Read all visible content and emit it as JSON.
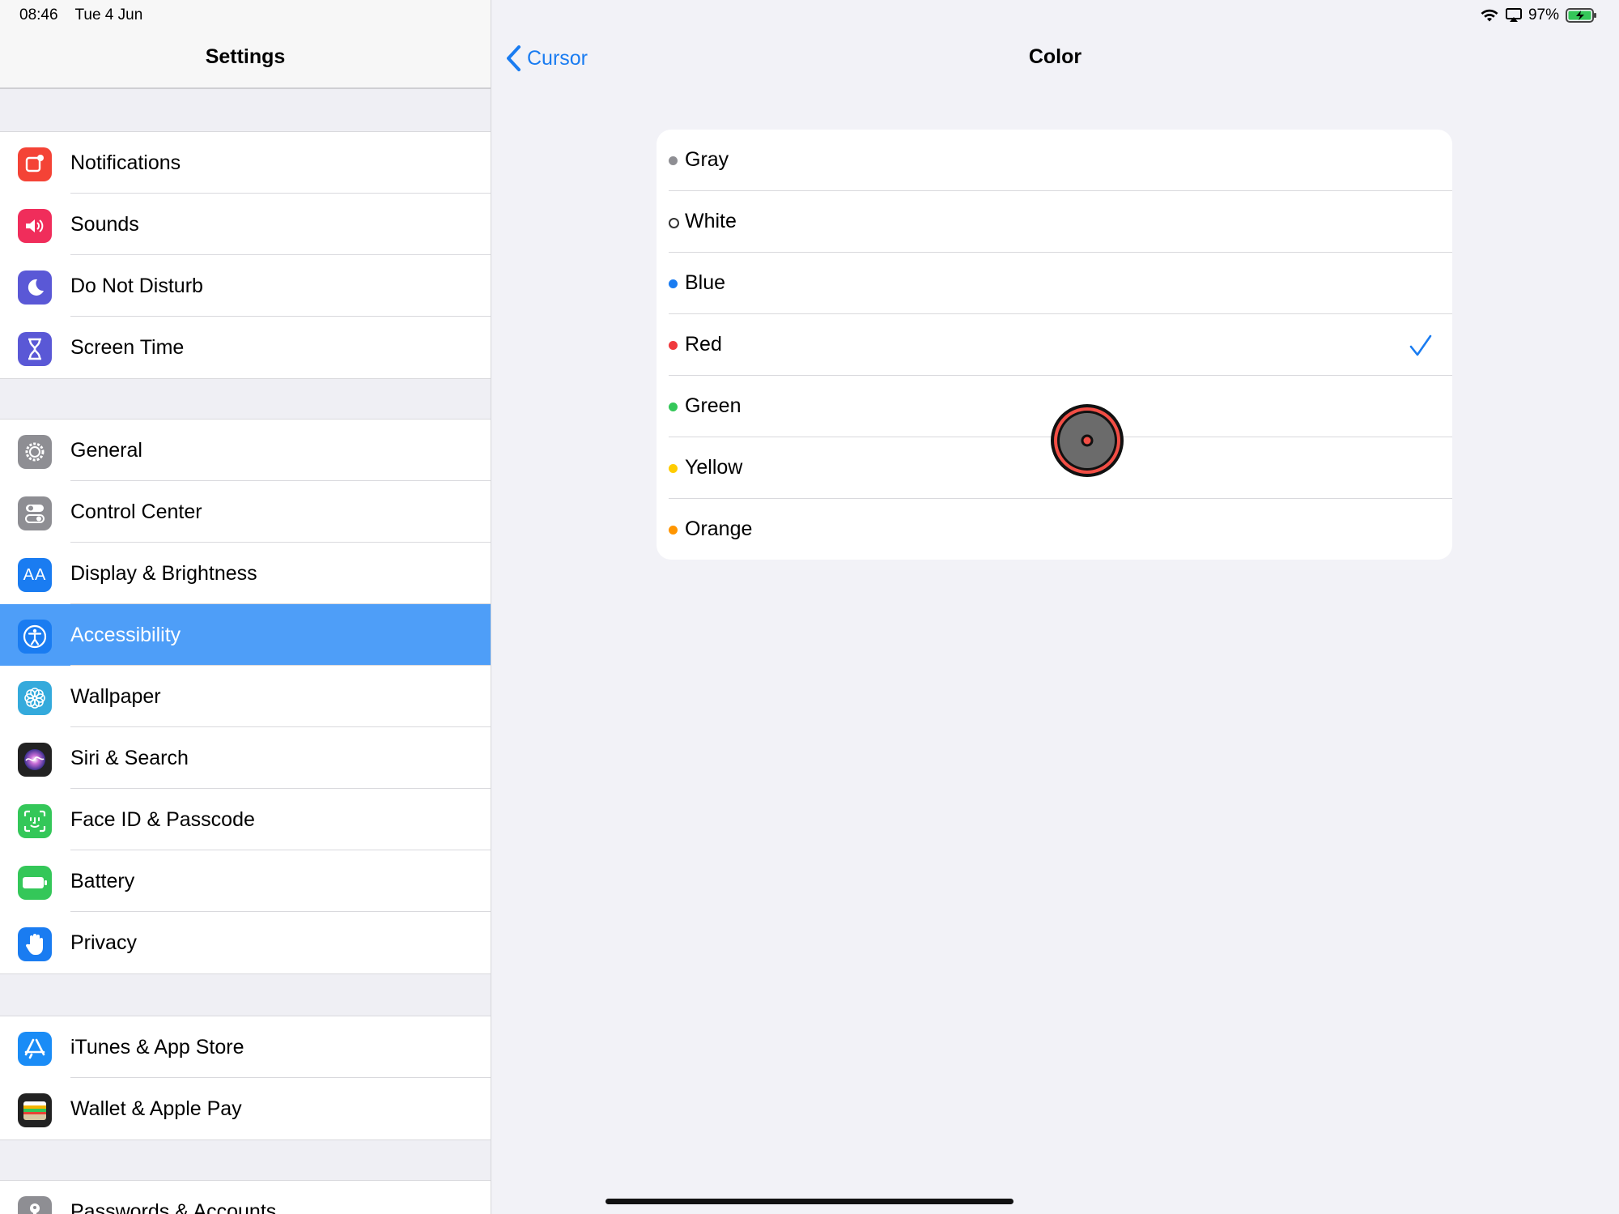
{
  "status": {
    "time": "08:46",
    "date": "Tue 4 Jun",
    "battery": "97%"
  },
  "sidebar": {
    "title": "Settings",
    "groups": [
      [
        {
          "label": "Notifications",
          "icon": "notifications-icon",
          "color": "#f44336"
        },
        {
          "label": "Sounds",
          "icon": "sounds-icon",
          "color": "#f02d5b"
        },
        {
          "label": "Do Not Disturb",
          "icon": "moon-icon",
          "color": "#5a58d6"
        },
        {
          "label": "Screen Time",
          "icon": "hourglass-icon",
          "color": "#5a58d6"
        }
      ],
      [
        {
          "label": "General",
          "icon": "gear-icon",
          "color": "#8e8e93"
        },
        {
          "label": "Control Center",
          "icon": "toggles-icon",
          "color": "#8e8e93"
        },
        {
          "label": "Display & Brightness",
          "icon": "display-icon",
          "color": "#1a7cf1"
        },
        {
          "label": "Accessibility",
          "icon": "accessibility-icon",
          "color": "#1a7cf1",
          "selected": true
        },
        {
          "label": "Wallpaper",
          "icon": "flower-icon",
          "color": "#34aadc"
        },
        {
          "label": "Siri & Search",
          "icon": "siri-icon",
          "color": "#222"
        },
        {
          "label": "Face ID & Passcode",
          "icon": "faceid-icon",
          "color": "#34c759"
        },
        {
          "label": "Battery",
          "icon": "battery-icon",
          "color": "#34c759"
        },
        {
          "label": "Privacy",
          "icon": "hand-icon",
          "color": "#1a7cf1"
        }
      ],
      [
        {
          "label": "iTunes & App Store",
          "icon": "appstore-icon",
          "color": "#1a8cf6"
        },
        {
          "label": "Wallet & Apple Pay",
          "icon": "wallet-icon",
          "color": "#222"
        }
      ],
      [
        {
          "label": "Passwords & Accounts",
          "icon": "key-icon",
          "color": "#8e8e93"
        }
      ]
    ]
  },
  "detail": {
    "back_label": "Cursor",
    "title": "Color",
    "options": [
      {
        "label": "Gray",
        "dot": "#8e8e93"
      },
      {
        "label": "White",
        "dot": "ring"
      },
      {
        "label": "Blue",
        "dot": "#1a7cf1"
      },
      {
        "label": "Red",
        "dot": "#f0393d",
        "checked": true
      },
      {
        "label": "Green",
        "dot": "#34c759"
      },
      {
        "label": "Yellow",
        "dot": "#ffcc00"
      },
      {
        "label": "Orange",
        "dot": "#ff9500"
      }
    ],
    "accent": "#1a7cf1"
  }
}
